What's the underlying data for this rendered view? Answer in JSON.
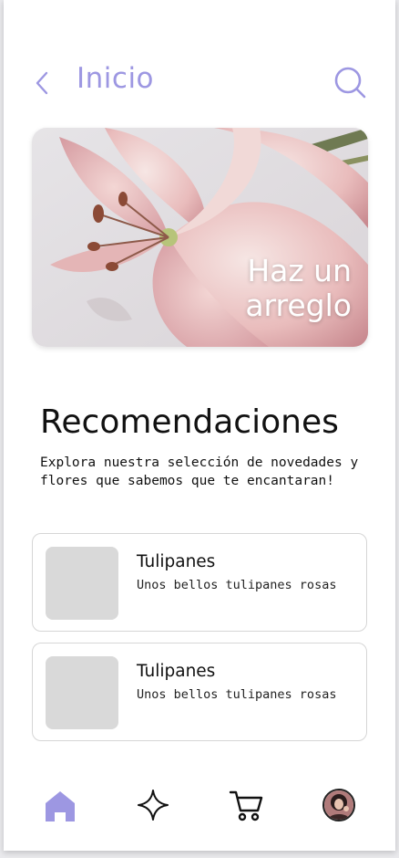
{
  "header": {
    "title": "Inicio",
    "back_icon": "chevron-left-icon",
    "search_icon": "search-icon"
  },
  "hero": {
    "text_line1": "Haz un",
    "text_line2": "arreglo",
    "image": "pink-lilies-photo"
  },
  "recommendations": {
    "title": "Recomendaciones",
    "description": "Explora nuestra selección  de novedades y flores que sabemos que te encantaran!",
    "items": [
      {
        "title": "Tulipanes",
        "subtitle": "Unos bellos tulipanes rosas"
      },
      {
        "title": "Tulipanes",
        "subtitle": "Unos bellos tulipanes rosas"
      }
    ]
  },
  "bottom_nav": {
    "items": [
      "home-icon",
      "sparkle-icon",
      "cart-icon",
      "profile-avatar"
    ],
    "active": "home-icon"
  },
  "colors": {
    "accent": "#9d97e2",
    "text": "#111111",
    "placeholder": "#d9d9d9",
    "border": "#d6d6d6"
  }
}
